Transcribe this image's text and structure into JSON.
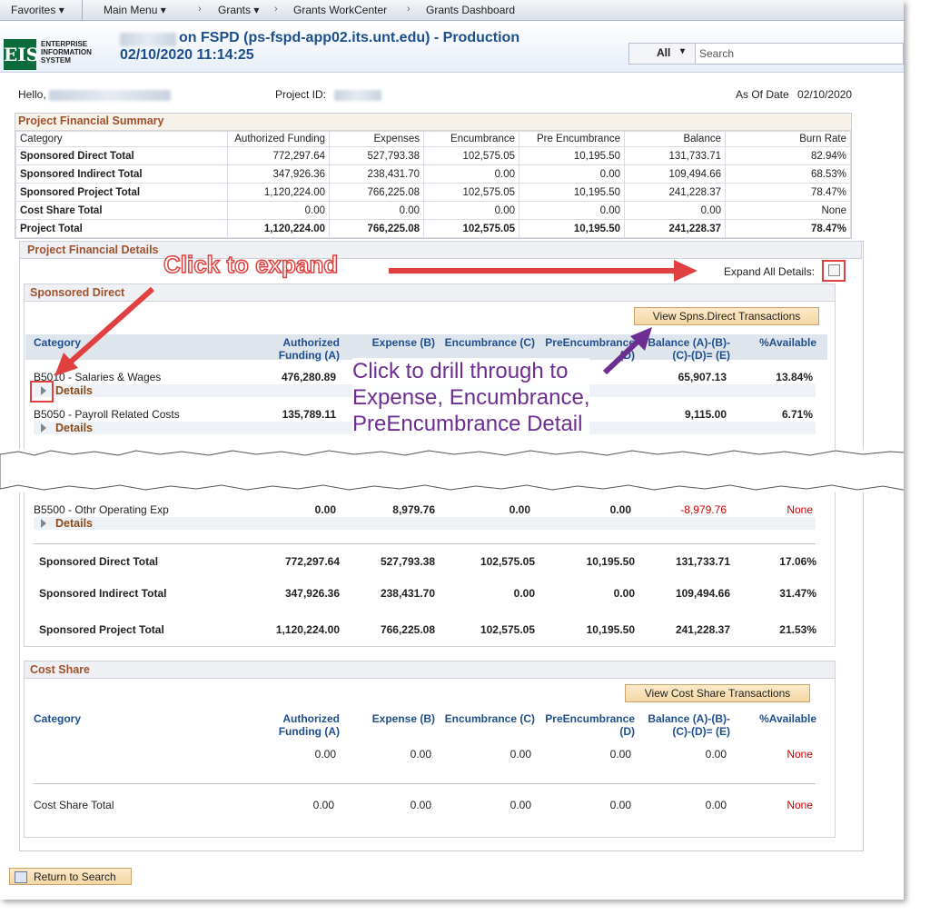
{
  "nav": {
    "favorites": "Favorites",
    "main_menu": "Main Menu",
    "grants": "Grants",
    "workcenter": "Grants WorkCenter",
    "dashboard": "Grants Dashboard"
  },
  "header": {
    "logo": "EIS",
    "logo_text": [
      "ENTERPRISE",
      "INFORMATION",
      "SYSTEM"
    ],
    "title": "on FSPD (ps-fspd-app02.its.unt.edu) - Production",
    "datetime": "02/10/2020 11:14:25",
    "search_scope": "All",
    "search_placeholder": "Search"
  },
  "info": {
    "hello": "Hello,",
    "project_id_label": "Project ID:",
    "as_of_label": "As Of Date",
    "as_of_value": "02/10/2020"
  },
  "summary": {
    "title": "Project Financial Summary",
    "columns": [
      "Category",
      "Authorized Funding",
      "Expenses",
      "Encumbrance",
      "Pre Encumbrance",
      "Balance",
      "Burn Rate"
    ],
    "rows": [
      [
        "Sponsored Direct Total",
        "772,297.64",
        "527,793.38",
        "102,575.05",
        "10,195.50",
        "131,733.71",
        "82.94%"
      ],
      [
        "Sponsored Indirect Total",
        "347,926.36",
        "238,431.70",
        "0.00",
        "0.00",
        "109,494.66",
        "68.53%"
      ],
      [
        "Sponsored Project Total",
        "1,120,224.00",
        "766,225.08",
        "102,575.05",
        "10,195.50",
        "241,228.37",
        "78.47%"
      ],
      [
        "Cost Share Total",
        "0.00",
        "0.00",
        "0.00",
        "0.00",
        "0.00",
        "None"
      ],
      [
        "Project Total",
        "1,120,224.00",
        "766,225.08",
        "102,575.05",
        "10,195.50",
        "241,228.37",
        "78.47%"
      ]
    ]
  },
  "details": {
    "title": "Project Financial Details",
    "expand_all_label": "Expand All Details:",
    "sponsored_direct": {
      "title": "Sponsored Direct",
      "button": "View Spns.Direct Transactions",
      "columns": {
        "category": "Category",
        "auth1": "Authorized",
        "auth2": "Funding (A)",
        "expense": "Expense (B)",
        "enc": "Encumbrance (C)",
        "pre1": "PreEncumbrance",
        "pre2": "(D)",
        "bal1": "Balance (A)-(B)-",
        "bal2": "(C)-(D)= (E)",
        "avail": "%Available"
      },
      "details_label": "Details",
      "rows": [
        {
          "cat": "B5010 - Salaries & Wages",
          "auth": "476,280.89",
          "exp": "",
          "enc": "",
          "pre": "",
          "bal": "65,907.13",
          "avail": "13.84%"
        },
        {
          "cat": "B5050 - Payroll Related Costs",
          "auth": "135,789.11",
          "exp": "",
          "enc": "",
          "pre": "",
          "bal": "9,115.00",
          "avail": "6.71%"
        },
        {
          "cat": "B5500 - Othr Operating Exp",
          "auth": "0.00",
          "exp": "8,979.76",
          "enc": "0.00",
          "pre": "0.00",
          "bal": "-8,979.76",
          "avail": "None"
        }
      ],
      "totals": [
        {
          "cat": "Sponsored Direct Total",
          "auth": "772,297.64",
          "exp": "527,793.38",
          "enc": "102,575.05",
          "pre": "10,195.50",
          "bal": "131,733.71",
          "avail": "17.06%"
        },
        {
          "cat": "Sponsored Indirect Total",
          "auth": "347,926.36",
          "exp": "238,431.70",
          "enc": "0.00",
          "pre": "0.00",
          "bal": "109,494.66",
          "avail": "31.47%"
        },
        {
          "cat": "Sponsored Project Total",
          "auth": "1,120,224.00",
          "exp": "766,225.08",
          "enc": "102,575.05",
          "pre": "10,195.50",
          "bal": "241,228.37",
          "avail": "21.53%"
        }
      ]
    },
    "cost_share": {
      "title": "Cost Share",
      "button": "View Cost Share Transactions",
      "row": {
        "auth": "0.00",
        "exp": "0.00",
        "enc": "0.00",
        "pre": "0.00",
        "bal": "0.00",
        "avail": "None"
      },
      "total": {
        "cat": "Cost Share Total",
        "auth": "0.00",
        "exp": "0.00",
        "enc": "0.00",
        "pre": "0.00",
        "bal": "0.00",
        "avail": "None"
      }
    }
  },
  "annotations": {
    "expand": "Click to expand",
    "drill": [
      "Click to drill through to",
      "Expense, Encumbrance,",
      "PreEncumbrance Detail"
    ]
  },
  "footer": {
    "return": "Return to Search"
  },
  "colors": {
    "section_title": "#a0522d",
    "column_header": "#1f4e8e",
    "negative": "#cc0000",
    "annotation_red": "#e04040",
    "annotation_purple": "#6d2d91"
  }
}
